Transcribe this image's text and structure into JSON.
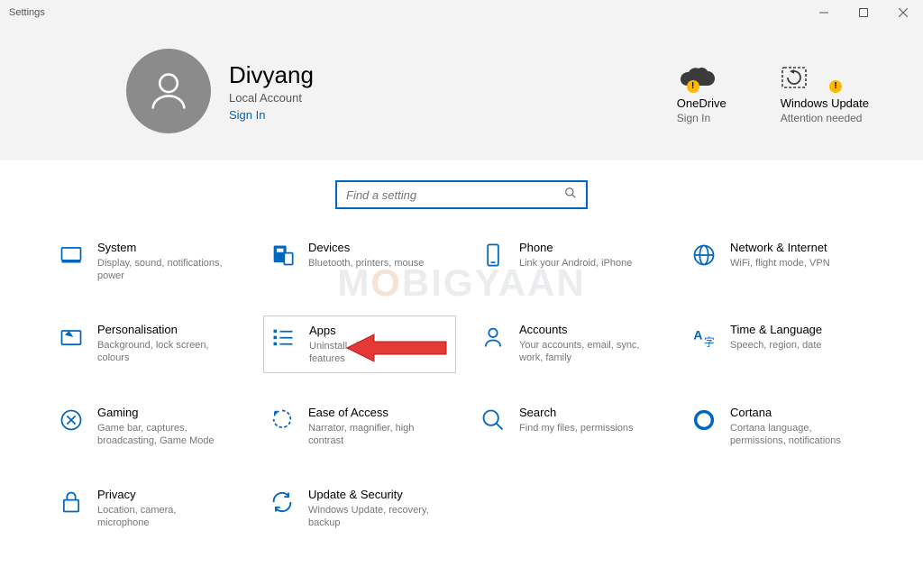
{
  "window": {
    "title": "Settings"
  },
  "user": {
    "name": "Divyang",
    "account_type": "Local Account",
    "signin_label": "Sign In"
  },
  "status": {
    "onedrive": {
      "title": "OneDrive",
      "subtitle": "Sign In"
    },
    "update": {
      "title": "Windows Update",
      "subtitle": "Attention needed"
    }
  },
  "search": {
    "placeholder": "Find a setting"
  },
  "categories": [
    {
      "id": "system",
      "title": "System",
      "subtitle": "Display, sound, notifications, power"
    },
    {
      "id": "devices",
      "title": "Devices",
      "subtitle": "Bluetooth, printers, mouse"
    },
    {
      "id": "phone",
      "title": "Phone",
      "subtitle": "Link your Android, iPhone"
    },
    {
      "id": "network",
      "title": "Network & Internet",
      "subtitle": "WiFi, flight mode, VPN"
    },
    {
      "id": "personalisation",
      "title": "Personalisation",
      "subtitle": "Background, lock screen, colours"
    },
    {
      "id": "apps",
      "title": "Apps",
      "subtitle": "Uninstall, defaults, optional features",
      "highlighted": true
    },
    {
      "id": "accounts",
      "title": "Accounts",
      "subtitle": "Your accounts, email, sync, work, family"
    },
    {
      "id": "time",
      "title": "Time & Language",
      "subtitle": "Speech, region, date"
    },
    {
      "id": "gaming",
      "title": "Gaming",
      "subtitle": "Game bar, captures, broadcasting, Game Mode"
    },
    {
      "id": "ease",
      "title": "Ease of Access",
      "subtitle": "Narrator, magnifier, high contrast"
    },
    {
      "id": "search",
      "title": "Search",
      "subtitle": "Find my files, permissions"
    },
    {
      "id": "cortana",
      "title": "Cortana",
      "subtitle": "Cortana language, permissions, notifications"
    },
    {
      "id": "privacy",
      "title": "Privacy",
      "subtitle": "Location, camera, microphone"
    },
    {
      "id": "update",
      "title": "Update & Security",
      "subtitle": "Windows Update, recovery, backup"
    }
  ],
  "watermark": {
    "prefix": "M",
    "accent": "O",
    "suffix": "BIGYAAN"
  }
}
